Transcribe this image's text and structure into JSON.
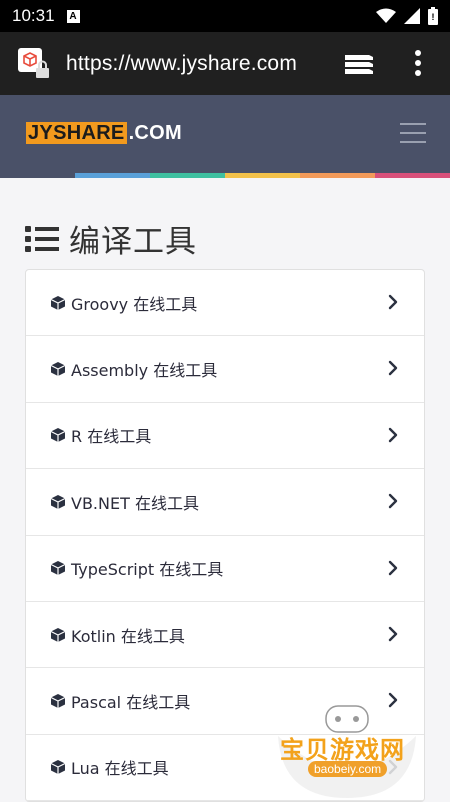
{
  "status_bar": {
    "time": "10:31",
    "notification_badge": "A"
  },
  "browser": {
    "url": "https://www.jyshare.com"
  },
  "site": {
    "logo_main": "JYSHARE",
    "logo_suffix": ".COM"
  },
  "color_strip": [
    "#4a5168",
    "#5aa0d8",
    "#3fc0a0",
    "#f2c14a",
    "#f29a5a",
    "#d8507a"
  ],
  "page": {
    "title": "编译工具"
  },
  "items": [
    "Groovy 在线工具",
    "Assembly 在线工具",
    "R 在线工具",
    "VB.NET 在线工具",
    "TypeScript 在线工具",
    "Kotlin 在线工具",
    "Pascal 在线工具",
    "Lua 在线工具"
  ],
  "watermark": {
    "text": "宝贝游戏网",
    "url": "baobeiy.com"
  }
}
